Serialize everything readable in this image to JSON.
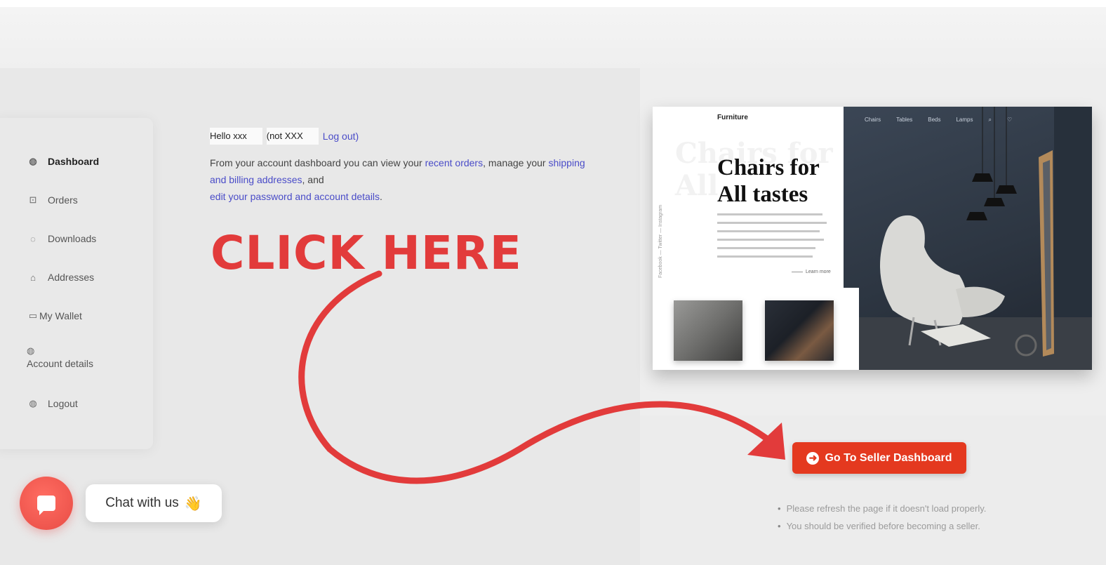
{
  "sidebar": {
    "items": [
      {
        "label": "Dashboard",
        "icon": "dashboard-icon",
        "glyph": "◍"
      },
      {
        "label": "Orders",
        "icon": "orders-icon",
        "glyph": "⊡"
      },
      {
        "label": "Downloads",
        "icon": "download-icon",
        "glyph": "◌"
      },
      {
        "label": "Addresses",
        "icon": "home-icon",
        "glyph": "⌂"
      },
      {
        "label": "My Wallet",
        "icon": "wallet-icon",
        "glyph": "▭"
      },
      {
        "label": "Account details",
        "icon": "user-icon",
        "glyph": "◍"
      },
      {
        "label": "Logout",
        "icon": "logout-icon",
        "glyph": "◍"
      }
    ]
  },
  "account": {
    "hello_prefix": "Hello xxx",
    "not_prefix": "(not XXX",
    "logout_link": "Log out)",
    "intro_1": "From your account dashboard you can view your ",
    "recent_orders": "recent orders",
    "intro_2": ", manage your ",
    "addresses_link": "shipping and billing addresses",
    "intro_3": ", and",
    "password_link": "edit your password and account details",
    "intro_4": "."
  },
  "overlay": {
    "click_here": "CLICK HERE"
  },
  "promo": {
    "brand": "Furniture",
    "ghost_title": "Chairs for All",
    "title": "Chairs for All tastes",
    "side_text": "Facebook — Twitter — Instagram",
    "learn_more": "Learn more",
    "nav": [
      "Chairs",
      "Tables",
      "Beds",
      "Lamps",
      "⌕",
      "♡"
    ]
  },
  "seller": {
    "button_label": "Go To Seller Dashboard",
    "button_color": "#e4391f",
    "notes": [
      "Please refresh the page if it doesn't load properly.",
      "You should be verified before becoming a seller."
    ]
  },
  "chat": {
    "label": "Chat with us",
    "emoji": "👋",
    "color": "#e84c45"
  }
}
